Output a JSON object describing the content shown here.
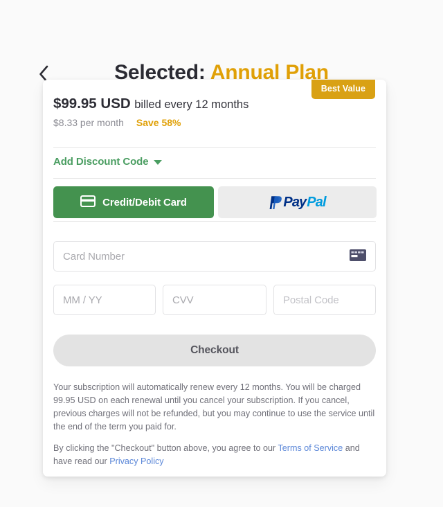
{
  "header": {
    "back_icon": "chevron-left-icon",
    "title_prefix": "Selected:",
    "plan_name": "Annual Plan"
  },
  "plan": {
    "badge": "Best Value",
    "price": "$99.95 USD",
    "billing_period": "billed every 12 months",
    "per_month": "$8.33 per month",
    "savings": "Save 58%"
  },
  "discount": {
    "label": "Add Discount Code",
    "caret_icon": "chevron-down-icon"
  },
  "payment_methods": {
    "card": {
      "label": "Credit/Debit Card",
      "icon": "credit-card-icon",
      "selected": true
    },
    "paypal": {
      "logo_first": "Pay",
      "logo_second": "Pal",
      "icon": "paypal-logo-icon",
      "selected": false
    }
  },
  "form": {
    "card_number": {
      "placeholder": "Card Number",
      "value": "",
      "icon": "credit-card-icon"
    },
    "expiry": {
      "placeholder": "MM / YY",
      "value": ""
    },
    "cvv": {
      "placeholder": "CVV",
      "value": ""
    },
    "postal": {
      "placeholder": "Postal Code",
      "value": ""
    }
  },
  "checkout": {
    "label": "Checkout"
  },
  "legal": {
    "renewal_notice": "Your subscription will automatically renew every 12 months. You will be charged 99.95 USD on each renewal until you cancel your subscription. If you cancel, previous charges will not be refunded, but you may continue to use the service until the end of the term you paid for.",
    "terms_prefix": "By clicking the \"Checkout\" button above, you agree to our ",
    "terms_link": "Terms of Service",
    "terms_middle": " and have read our ",
    "privacy_link": "Privacy Policy"
  },
  "colors": {
    "accent_gold": "#d9a114",
    "accent_green": "#44924f",
    "discount_green": "#4b9e62",
    "link_blue": "#5b87d8",
    "paypal_navy": "#003087",
    "paypal_blue": "#009cde"
  }
}
